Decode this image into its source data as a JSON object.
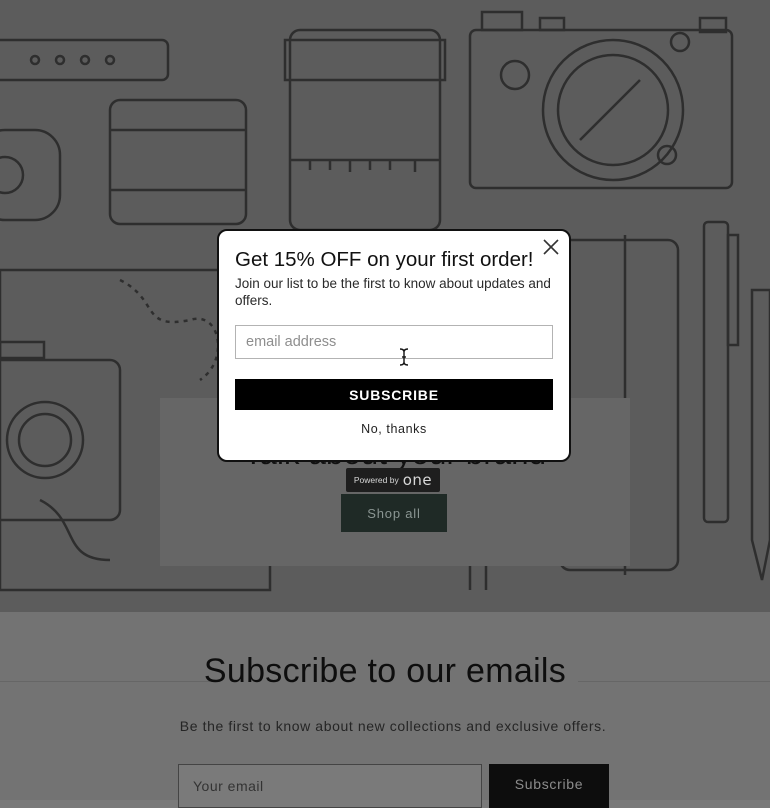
{
  "hero": {
    "heading": "Talk about your brand",
    "shop_all_label": "Shop all",
    "powered_by_label": "Powered by",
    "powered_by_brand": "one"
  },
  "footer": {
    "title": "Subscribe to our emails",
    "text": "Be the first to know about new collections and exclusive offers.",
    "email_placeholder": "Your email",
    "subscribe_label": "Subscribe"
  },
  "modal": {
    "title": "Get 15% OFF on your first order!",
    "description": "Join our list to be the first to know about updates and offers.",
    "email_placeholder": "email address",
    "subscribe_label": "SUBSCRIBE",
    "dismiss_label": "No, thanks"
  },
  "icons": {
    "close": "close-icon",
    "cursor": "text-cursor-icon"
  },
  "colors": {
    "overlay_bg": "#5c5c5c",
    "modal_bg": "#ffffff",
    "modal_button": "#000000"
  }
}
